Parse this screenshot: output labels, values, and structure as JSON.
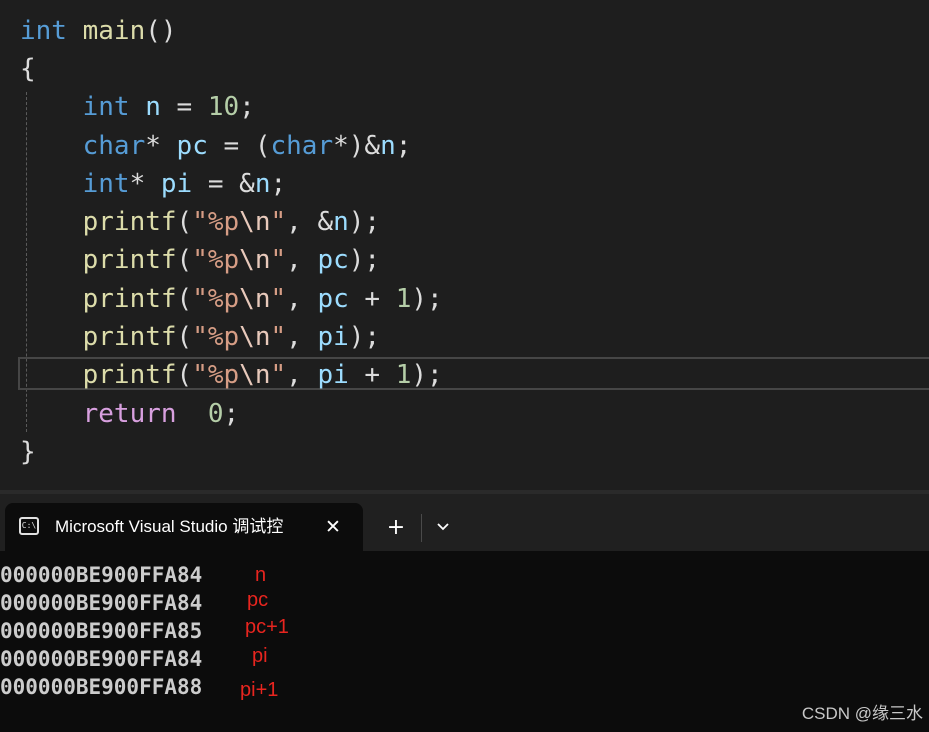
{
  "editor": {
    "lines": [
      {
        "tokens": [
          {
            "text": "int",
            "type": "kw"
          },
          {
            "text": " main",
            "type": "fn"
          },
          {
            "text": "()",
            "type": "punc"
          }
        ]
      },
      {
        "tokens": [
          {
            "text": "{",
            "type": "punc"
          }
        ]
      },
      {
        "tokens": [
          {
            "text": "    int",
            "type": "kw"
          },
          {
            "text": " n",
            "type": "var"
          },
          {
            "text": " = ",
            "type": "punc"
          },
          {
            "text": "10",
            "type": "num"
          },
          {
            "text": ";",
            "type": "punc"
          }
        ]
      },
      {
        "tokens": [
          {
            "text": "    char",
            "type": "kw"
          },
          {
            "text": "* ",
            "type": "punc"
          },
          {
            "text": "pc",
            "type": "var"
          },
          {
            "text": " = (",
            "type": "punc"
          },
          {
            "text": "char",
            "type": "kw"
          },
          {
            "text": "*)&",
            "type": "punc"
          },
          {
            "text": "n",
            "type": "var"
          },
          {
            "text": ";",
            "type": "punc"
          }
        ]
      },
      {
        "tokens": [
          {
            "text": "    int",
            "type": "kw"
          },
          {
            "text": "* ",
            "type": "punc"
          },
          {
            "text": "pi",
            "type": "var"
          },
          {
            "text": " = &",
            "type": "punc"
          },
          {
            "text": "n",
            "type": "var"
          },
          {
            "text": ";",
            "type": "punc"
          }
        ]
      },
      {
        "tokens": [
          {
            "text": "    printf",
            "type": "fn"
          },
          {
            "text": "(",
            "type": "punc"
          },
          {
            "text": "\"%p",
            "type": "str"
          },
          {
            "text": "\\n",
            "type": "esc"
          },
          {
            "text": "\"",
            "type": "str"
          },
          {
            "text": ", &",
            "type": "punc"
          },
          {
            "text": "n",
            "type": "var"
          },
          {
            "text": ");",
            "type": "punc"
          }
        ]
      },
      {
        "tokens": [
          {
            "text": "    printf",
            "type": "fn"
          },
          {
            "text": "(",
            "type": "punc"
          },
          {
            "text": "\"%p",
            "type": "str"
          },
          {
            "text": "\\n",
            "type": "esc"
          },
          {
            "text": "\"",
            "type": "str"
          },
          {
            "text": ", ",
            "type": "punc"
          },
          {
            "text": "pc",
            "type": "var"
          },
          {
            "text": ");",
            "type": "punc"
          }
        ]
      },
      {
        "tokens": [
          {
            "text": "    printf",
            "type": "fn"
          },
          {
            "text": "(",
            "type": "punc"
          },
          {
            "text": "\"%p",
            "type": "str"
          },
          {
            "text": "\\n",
            "type": "esc"
          },
          {
            "text": "\"",
            "type": "str"
          },
          {
            "text": ", ",
            "type": "punc"
          },
          {
            "text": "pc",
            "type": "var"
          },
          {
            "text": " + ",
            "type": "punc"
          },
          {
            "text": "1",
            "type": "num"
          },
          {
            "text": ");",
            "type": "punc"
          }
        ]
      },
      {
        "tokens": [
          {
            "text": "    printf",
            "type": "fn"
          },
          {
            "text": "(",
            "type": "punc"
          },
          {
            "text": "\"%p",
            "type": "str"
          },
          {
            "text": "\\n",
            "type": "esc"
          },
          {
            "text": "\"",
            "type": "str"
          },
          {
            "text": ", ",
            "type": "punc"
          },
          {
            "text": "pi",
            "type": "var"
          },
          {
            "text": ");",
            "type": "punc"
          }
        ]
      },
      {
        "tokens": [
          {
            "text": "    printf",
            "type": "fn"
          },
          {
            "text": "(",
            "type": "punc"
          },
          {
            "text": "\"%p",
            "type": "str"
          },
          {
            "text": "\\n",
            "type": "esc"
          },
          {
            "text": "\"",
            "type": "str"
          },
          {
            "text": ", ",
            "type": "punc"
          },
          {
            "text": "pi",
            "type": "var"
          },
          {
            "text": " + ",
            "type": "punc"
          },
          {
            "text": "1",
            "type": "num"
          },
          {
            "text": ");",
            "type": "punc"
          }
        ]
      },
      {
        "tokens": [
          {
            "text": "    return",
            "type": "ctl"
          },
          {
            "text": "  ",
            "type": "punc"
          },
          {
            "text": "0",
            "type": "num"
          },
          {
            "text": ";",
            "type": "punc"
          }
        ]
      },
      {
        "tokens": [
          {
            "text": "}",
            "type": "punc"
          }
        ]
      }
    ],
    "colors": {
      "keyword": "#569cd6",
      "control": "#d8a0df",
      "function": "#dcdcaa",
      "variable": "#9cdcfe",
      "number": "#b5cea8",
      "string": "#d69d85"
    }
  },
  "terminal": {
    "tab_title": "Microsoft Visual Studio 调试控",
    "tab_icon": "terminal-icon",
    "tab_icon_text": "C:\\",
    "close_glyph": "✕",
    "new_tab_glyph": "+",
    "dropdown_icon": "chevron-down-icon",
    "output": [
      {
        "text": "000000BE900FFA84",
        "note": "n"
      },
      {
        "text": "000000BE900FFA84",
        "note": "pc"
      },
      {
        "text": "000000BE900FFA85",
        "note": "pc+1"
      },
      {
        "text": "000000BE900FFA84",
        "note": "pi"
      },
      {
        "text": "000000BE900FFA88",
        "note": "pi+1"
      }
    ],
    "annotation_color": "#e8251f"
  },
  "watermark": "CSDN @缘三水"
}
